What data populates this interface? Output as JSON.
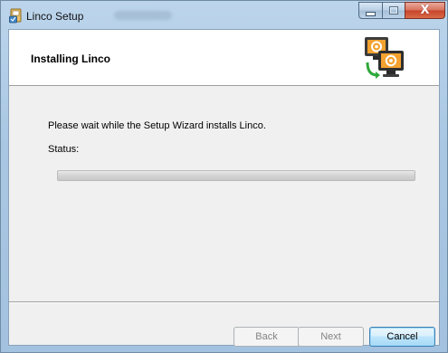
{
  "window": {
    "title": "Linco Setup",
    "controls": {
      "minimize_icon": "minimize-icon",
      "maximize_icon": "maximize-icon",
      "close_icon": "close-icon",
      "close_glyph": "X"
    }
  },
  "banner": {
    "title": "Installing Linco",
    "icon": "network-computers-icon"
  },
  "body": {
    "description": "Please wait while the Setup Wizard installs Linco.",
    "status_label": "Status:"
  },
  "progress": {
    "value": 0
  },
  "buttons": {
    "back": "Back",
    "next": "Next",
    "cancel": "Cancel"
  },
  "colors": {
    "title_bar": "#a9c7e3",
    "close_button": "#c7432a",
    "dialog_background": "#f0f0f0",
    "banner_background": "#ffffff",
    "cancel_border": "#3c7fb1"
  }
}
